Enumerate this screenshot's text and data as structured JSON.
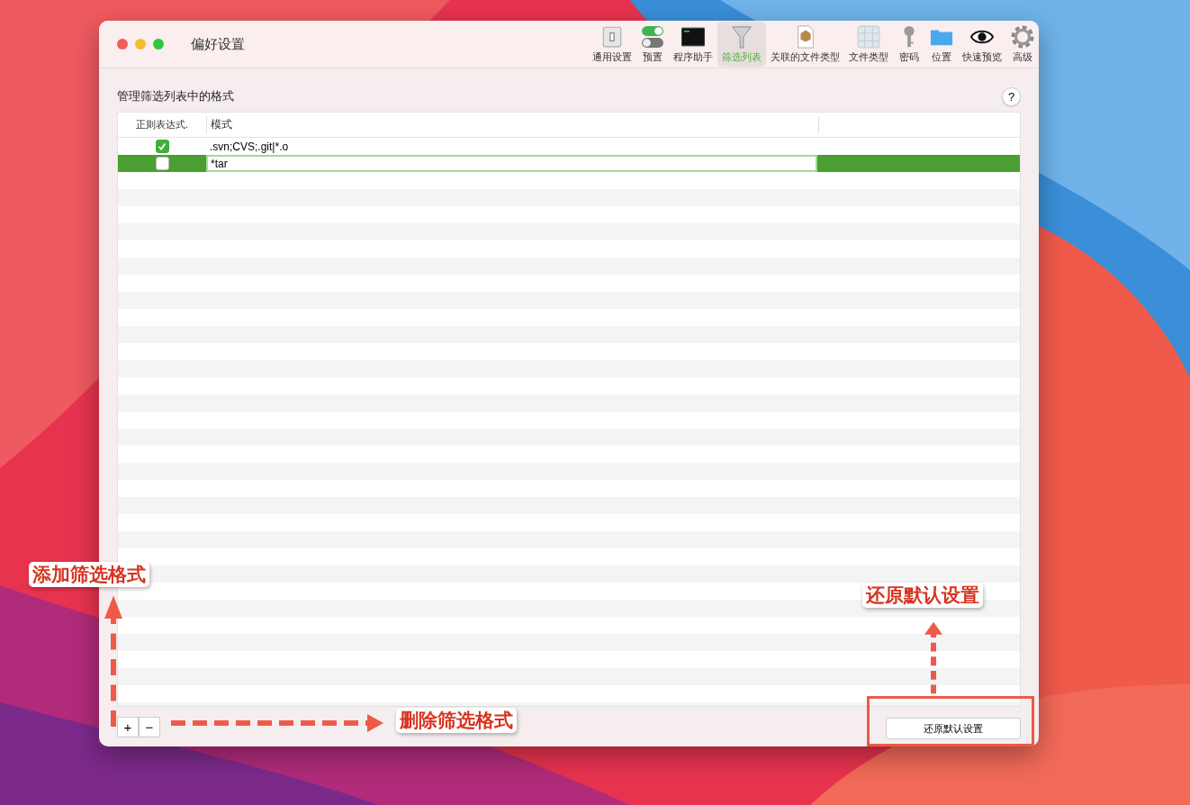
{
  "window": {
    "title": "偏好设置"
  },
  "toolbar": [
    {
      "label": "通用设置",
      "selected": false
    },
    {
      "label": "预置",
      "selected": false
    },
    {
      "label": "程序助手",
      "selected": false
    },
    {
      "label": "筛选列表",
      "selected": true
    },
    {
      "label": "关联的文件类型",
      "selected": false
    },
    {
      "label": "文件类型",
      "selected": false
    },
    {
      "label": "密码",
      "selected": false
    },
    {
      "label": "位置",
      "selected": false
    },
    {
      "label": "快速预览",
      "selected": false
    },
    {
      "label": "高级",
      "selected": false
    }
  ],
  "heading": "管理筛选列表中的格式",
  "help_button": "?",
  "table": {
    "columns": [
      "正则表达式.",
      "模式"
    ],
    "rows": [
      {
        "regex": true,
        "pattern": ".svn;CVS;.git|*.o",
        "selected": false,
        "editing": false
      },
      {
        "regex": false,
        "pattern": "*tar",
        "selected": true,
        "editing": true
      }
    ]
  },
  "add_button": "+",
  "remove_button": "−",
  "restore_button": "还原默认设置",
  "annotations": [
    {
      "text": "添加筛选格式",
      "kind": "up",
      "highlight": false
    },
    {
      "text": "删除筛选格式",
      "kind": "right",
      "highlight": false
    },
    {
      "text": "还原默认设置",
      "kind": "up",
      "highlight": true
    }
  ]
}
